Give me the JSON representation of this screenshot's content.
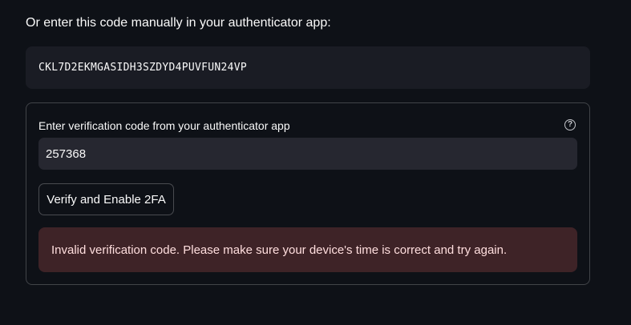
{
  "intro_text": "Or enter this code manually in your authenticator app:",
  "secret_code": "CKL7D2EKMGASIDH3SZDYD4PUVFUN24VP",
  "form": {
    "field_label": "Enter verification code from your authenticator app",
    "help_icon": "question-circle-icon",
    "input_value": "257368",
    "verify_button_label": "Verify and Enable 2FA",
    "error_message": "Invalid verification code. Please make sure your device's time is correct and try again."
  },
  "colors": {
    "background": "#0e1117",
    "code_box": "#1a1c24",
    "input_background": "#262730",
    "error_background": "#3e2327",
    "error_text": "#ffdede"
  }
}
